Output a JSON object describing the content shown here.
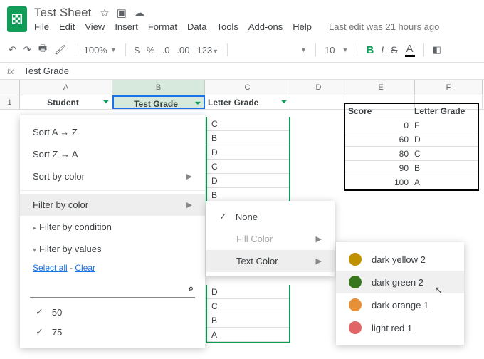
{
  "doc": {
    "title": "Test Sheet",
    "last_edit": "Last edit was 21 hours ago"
  },
  "menus": [
    "File",
    "Edit",
    "View",
    "Insert",
    "Format",
    "Data",
    "Tools",
    "Add-ons",
    "Help"
  ],
  "toolbar": {
    "zoom": "100%",
    "currency": "$",
    "percent": "%",
    "dec_dec": ".0",
    "dec_inc": ".00",
    "format": "123",
    "font_size": "10"
  },
  "fx": {
    "value": "Test Grade"
  },
  "cols": [
    "A",
    "B",
    "C",
    "D",
    "E",
    "F"
  ],
  "headers": {
    "a": "Student",
    "b": "Test Grade",
    "c": "Letter Grade"
  },
  "letters1": [
    "C",
    "B",
    "D",
    "C",
    "D",
    "B"
  ],
  "letters2": [
    "D",
    "C",
    "B",
    "A"
  ],
  "score_table": {
    "head_score": "Score",
    "head_letter": "Letter Grade",
    "rows": [
      {
        "s": "0",
        "l": "F"
      },
      {
        "s": "60",
        "l": "D"
      },
      {
        "s": "80",
        "l": "C"
      },
      {
        "s": "90",
        "l": "B"
      },
      {
        "s": "100",
        "l": "A"
      }
    ]
  },
  "ctx": {
    "sort_az": "Sort A → Z",
    "sort_za": "Sort Z → A",
    "sort_color": "Sort by color",
    "filter_color": "Filter by color",
    "filter_cond": "Filter by condition",
    "filter_vals": "Filter by values",
    "select_all": "Select all",
    "clear": "Clear",
    "v1": "50",
    "v2": "75"
  },
  "sub": {
    "none": "None",
    "fill": "Fill Color",
    "text": "Text Color"
  },
  "colors": [
    {
      "name": "dark yellow 2",
      "hex": "#bf9000"
    },
    {
      "name": "dark green 2",
      "hex": "#38761d"
    },
    {
      "name": "dark orange 1",
      "hex": "#e69138"
    },
    {
      "name": "light red 1",
      "hex": "#e06666"
    }
  ]
}
